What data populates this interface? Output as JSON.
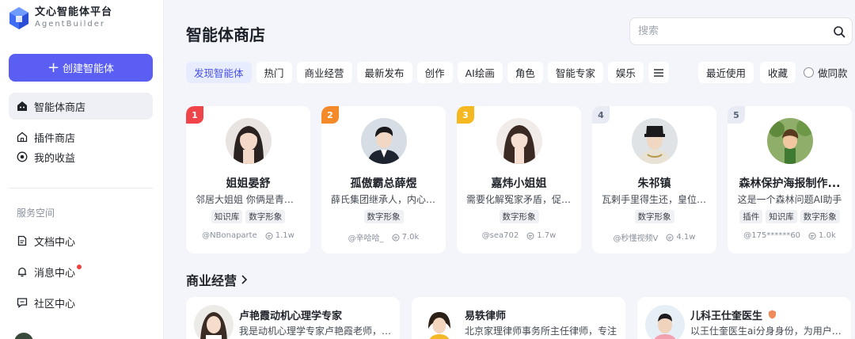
{
  "app": {
    "logo_title": "文心智能体平台",
    "logo_subtitle": "AgentBuilder"
  },
  "sidebar": {
    "create_label": "创建智能体",
    "items": [
      {
        "label": "智能体商店",
        "icon": "robot-icon"
      },
      {
        "label": "插件商店",
        "icon": "home-plugin-icon"
      },
      {
        "label": "我的收益",
        "icon": "earnings-icon"
      }
    ],
    "section_label": "服务空间",
    "service_items": [
      {
        "label": "文档中心",
        "icon": "document-icon"
      },
      {
        "label": "消息中心",
        "icon": "bell-icon"
      },
      {
        "label": "社区中心",
        "icon": "chat-icon"
      }
    ]
  },
  "main": {
    "title": "智能体商店",
    "search_placeholder": "搜索",
    "categories": [
      "发现智能体",
      "热门",
      "商业经营",
      "最新发布",
      "创作",
      "AI绘画",
      "角色",
      "智能专家",
      "娱乐"
    ],
    "right_filters": [
      "最近使用",
      "收藏"
    ],
    "radio_label": "做同款",
    "colors": {
      "accent": "#5a5ef2",
      "rank1": "#f0444b",
      "rank2": "#f58a2a",
      "rank3": "#f5b820",
      "rank_other": "#e8ebf3"
    }
  },
  "top_agents": [
    {
      "rank": "1",
      "title": "姐姐晏舒",
      "desc": "邻居大姐姐 你俩是青梅竹马",
      "tags": [
        "知识库",
        "数字形象"
      ],
      "author": "@NBonaparte",
      "uses": "1.1w"
    },
    {
      "rank": "2",
      "title": "孤傲霸总薛煜",
      "desc": "薛氏集团继承人，内心冷漠",
      "tags": [
        "数字形象"
      ],
      "author": "@辛哈哈_",
      "uses": "7.0k"
    },
    {
      "rank": "3",
      "title": "嘉炜小姐姐",
      "desc": "需要化解冤家矛盾，促进和好",
      "tags": [
        "数字形象"
      ],
      "author": "@sea702",
      "uses": "1.7w"
    },
    {
      "rank": "4",
      "title": "朱祁镇",
      "desc": "瓦剌手里得生还，皇位复得",
      "tags": [
        "数字形象"
      ],
      "author": "@秒懂视频V",
      "uses": "4.1w"
    },
    {
      "rank": "5",
      "title": "森林保护海报制作...",
      "desc": "这是一个森林问题AI助手",
      "tags": [
        "插件",
        "知识库",
        "数字形象"
      ],
      "author": "@175******60",
      "uses": "1.0k"
    }
  ],
  "business": {
    "title": "商业经营",
    "items": [
      {
        "name": "卢艳霞动机心理学专家",
        "desc": "我是动机心理学专家卢艳霞老师，擅长"
      },
      {
        "name": "易轶律师",
        "desc": "北京家理律师事务所主任律师，专注"
      },
      {
        "name": "儿科王仕奎医生",
        "desc": "以王仕奎医生ai分身身份，为用户解答"
      }
    ]
  }
}
